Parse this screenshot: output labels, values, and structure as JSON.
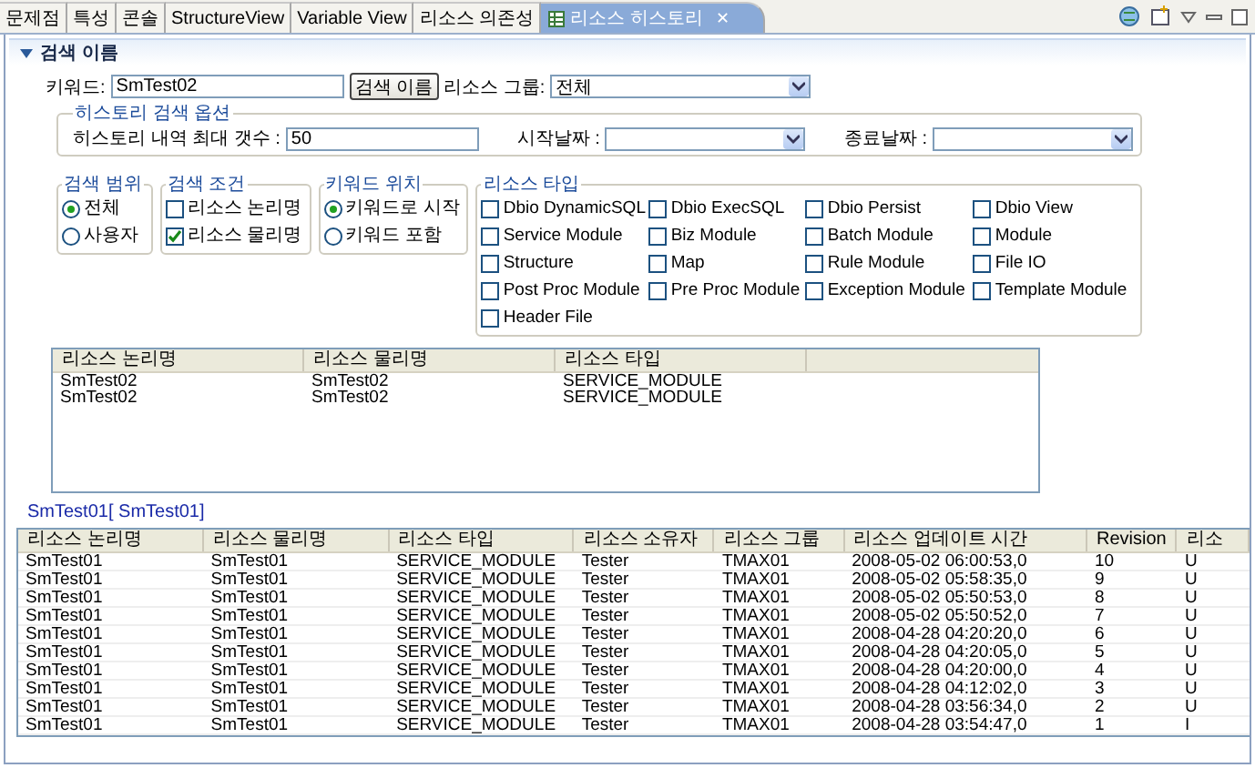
{
  "tabs": [
    {
      "label": "문제점",
      "selected": false
    },
    {
      "label": "특성",
      "selected": false
    },
    {
      "label": "콘솔",
      "selected": false
    },
    {
      "label": "StructureView",
      "selected": false
    },
    {
      "label": "Variable View",
      "selected": false
    },
    {
      "label": "리소스 의존성",
      "selected": false
    },
    {
      "label": "리소스 히스토리",
      "selected": true,
      "close": "✕"
    }
  ],
  "section": {
    "title": "검색 이름",
    "expanded": true
  },
  "search": {
    "keyword_label": "키워드:",
    "keyword": "SmTest02",
    "button": "검색 이름",
    "group_label": "리소스 그룹:",
    "group_value": "전체"
  },
  "history_options": {
    "title": "히스토리 검색 옵션",
    "max_label": "히스토리 내역 최대 갯수 :",
    "max_value": "50",
    "start_label": "시작날짜 :",
    "end_label": "종료날짜 :"
  },
  "scope": {
    "title": "검색 범위",
    "options": [
      {
        "label": "전체",
        "selected": true
      },
      {
        "label": "사용자",
        "selected": false
      }
    ]
  },
  "condition": {
    "title": "검색 조건",
    "options": [
      {
        "label": "리소스 논리명",
        "checked": false
      },
      {
        "label": "리소스 물리명",
        "checked": true
      }
    ]
  },
  "keyword_position": {
    "title": "키워드 위치",
    "options": [
      {
        "label": "키워드로 시작",
        "selected": true
      },
      {
        "label": "키워드 포함",
        "selected": false
      }
    ]
  },
  "resource_types": {
    "title": "리소스 타입",
    "options": [
      {
        "label": "Dbio DynamicSQL",
        "checked": false
      },
      {
        "label": "Dbio ExecSQL",
        "checked": false
      },
      {
        "label": "Dbio Persist",
        "checked": false
      },
      {
        "label": "Dbio View",
        "checked": false
      },
      {
        "label": "Service Module",
        "checked": false
      },
      {
        "label": "Biz Module",
        "checked": false
      },
      {
        "label": "Batch Module",
        "checked": false
      },
      {
        "label": "Module",
        "checked": false
      },
      {
        "label": "Structure",
        "checked": false
      },
      {
        "label": "Map",
        "checked": false
      },
      {
        "label": "Rule Module",
        "checked": false
      },
      {
        "label": "File IO",
        "checked": false
      },
      {
        "label": "Post Proc Module",
        "checked": false
      },
      {
        "label": "Pre Proc Module",
        "checked": false
      },
      {
        "label": "Exception Module",
        "checked": false
      },
      {
        "label": "Template Module",
        "checked": false
      },
      {
        "label": "Header File",
        "checked": false
      }
    ]
  },
  "results": {
    "columns": [
      "리소스 논리명",
      "리소스 물리명",
      "리소스 타입"
    ],
    "rows": [
      [
        "SmTest02",
        "SmTest02",
        "SERVICE_MODULE"
      ],
      [
        "SmTest02",
        "SmTest02",
        "SERVICE_MODULE"
      ]
    ]
  },
  "selection_label": "SmTest01[ SmTest01]",
  "history": {
    "columns": [
      "리소스 논리명",
      "리소스 물리명",
      "리소스 타입",
      "리소스 소유자",
      "리소스 그룹",
      "리소스 업데이트 시간",
      "Revision",
      "리소"
    ],
    "rows": [
      [
        "SmTest01",
        "SmTest01",
        "SERVICE_MODULE",
        "Tester",
        "TMAX01",
        "2008-05-02 06:00:53,0",
        "10",
        "U"
      ],
      [
        "SmTest01",
        "SmTest01",
        "SERVICE_MODULE",
        "Tester",
        "TMAX01",
        "2008-05-02 05:58:35,0",
        "9",
        "U"
      ],
      [
        "SmTest01",
        "SmTest01",
        "SERVICE_MODULE",
        "Tester",
        "TMAX01",
        "2008-05-02 05:50:53,0",
        "8",
        "U"
      ],
      [
        "SmTest01",
        "SmTest01",
        "SERVICE_MODULE",
        "Tester",
        "TMAX01",
        "2008-05-02 05:50:52,0",
        "7",
        "U"
      ],
      [
        "SmTest01",
        "SmTest01",
        "SERVICE_MODULE",
        "Tester",
        "TMAX01",
        "2008-04-28 04:20:20,0",
        "6",
        "U"
      ],
      [
        "SmTest01",
        "SmTest01",
        "SERVICE_MODULE",
        "Tester",
        "TMAX01",
        "2008-04-28 04:20:05,0",
        "5",
        "U"
      ],
      [
        "SmTest01",
        "SmTest01",
        "SERVICE_MODULE",
        "Tester",
        "TMAX01",
        "2008-04-28 04:20:00,0",
        "4",
        "U"
      ],
      [
        "SmTest01",
        "SmTest01",
        "SERVICE_MODULE",
        "Tester",
        "TMAX01",
        "2008-04-28 04:12:02,0",
        "3",
        "U"
      ],
      [
        "SmTest01",
        "SmTest01",
        "SERVICE_MODULE",
        "Tester",
        "TMAX01",
        "2008-04-28 03:56:34,0",
        "2",
        "U"
      ],
      [
        "SmTest01",
        "SmTest01",
        "SERVICE_MODULE",
        "Tester",
        "TMAX01",
        "2008-04-28 03:54:47,0",
        "1",
        "I"
      ]
    ]
  }
}
